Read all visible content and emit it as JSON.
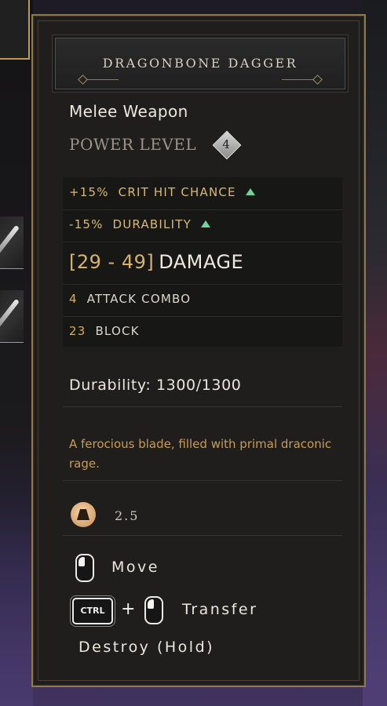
{
  "item": {
    "name": "DRAGONBONE DAGGER",
    "type": "Melee Weapon",
    "power_label": "POWER LEVEL",
    "power_level": "4"
  },
  "stats": [
    {
      "value": "+15%",
      "label": "CRIT HIT CHANCE",
      "arrow": true
    },
    {
      "value": "-15%",
      "label": "DURABILITY",
      "arrow": true
    }
  ],
  "damage": {
    "value": "[29 - 49]",
    "label": "DAMAGE"
  },
  "other_stats": [
    {
      "value": "4",
      "label": "ATTACK COMBO"
    },
    {
      "value": "23",
      "label": "BLOCK"
    }
  ],
  "durability": "Durability: 1300/1300",
  "flavor": "A ferocious blade, filled with primal draconic rage.",
  "weight": "2.5",
  "controls": {
    "move": "Move",
    "ctrl_key": "CTRL",
    "plus": "+",
    "transfer": "Transfer",
    "destroy": "Destroy (Hold)"
  },
  "colors": {
    "accent_gold": "#d2ac64",
    "upgrade_green": "#6fd39a",
    "panel_border": "#8d7a4f"
  },
  "icons": [
    "weight-icon",
    "mouse-left-icon",
    "ctrl-key-icon",
    "upgrade-arrow-icon",
    "power-level-diamond-icon"
  ]
}
